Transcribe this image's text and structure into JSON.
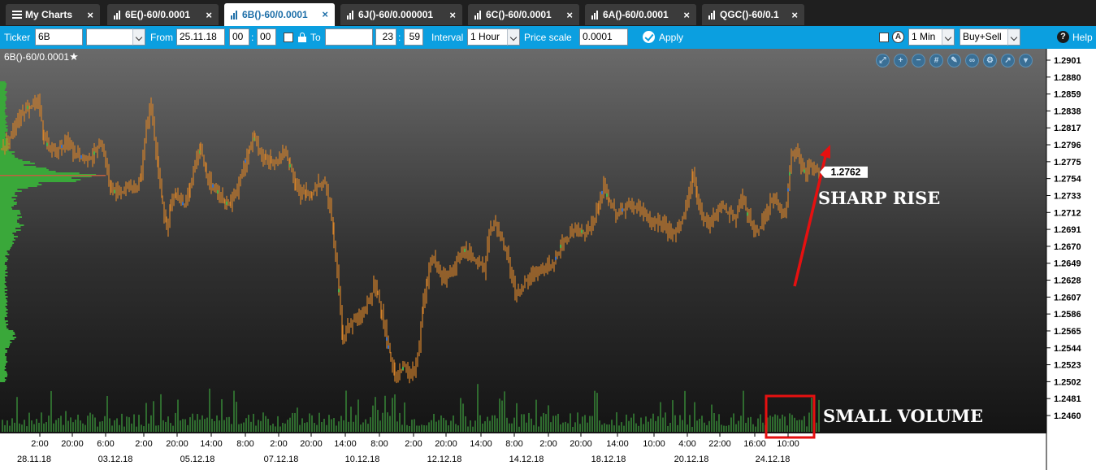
{
  "tabs": [
    {
      "label": "My Charts",
      "icon": "menu-icon",
      "active": false
    },
    {
      "label": "6E()-60/0.0001",
      "icon": "bar-chart-icon",
      "active": false
    },
    {
      "label": "6B()-60/0.0001",
      "icon": "bar-chart-icon",
      "active": true
    },
    {
      "label": "6J()-60/0.000001",
      "icon": "bar-chart-icon",
      "active": false
    },
    {
      "label": "6C()-60/0.0001",
      "icon": "bar-chart-icon",
      "active": false
    },
    {
      "label": "6A()-60/0.0001",
      "icon": "bar-chart-icon",
      "active": false
    },
    {
      "label": "QGC()-60/0.1",
      "icon": "bar-chart-icon",
      "active": false
    }
  ],
  "tab_close_glyph": "×",
  "toolbar": {
    "ticker_label": "Ticker",
    "ticker_value": "6B",
    "ticker_dropdown_value": "",
    "from_label": "From",
    "from_date": "25.11.18",
    "from_hour": "00",
    "from_minute": "00",
    "to_label": "To",
    "to_date": "",
    "to_hour": "23",
    "to_minute": "59",
    "time_separator": ":",
    "interval_label": "Interval",
    "interval_value": "1 Hour",
    "price_scale_label": "Price scale",
    "price_scale_value": "0.0001",
    "apply_label": "Apply",
    "circle_icon_glyph": "A",
    "timeframe_value": "1 Min",
    "side_value": "Buy+Sell",
    "help_label": "Help",
    "help_glyph": "?"
  },
  "chart": {
    "title": "6B()-60/0.0001",
    "star_glyph": "★",
    "tool_icons": [
      "zoom-fit-icon",
      "zoom-in-icon",
      "zoom-out-icon",
      "grid-icon",
      "draw-icon",
      "link-icon",
      "settings-icon",
      "expand-icon",
      "collapse-icon"
    ],
    "tool_glyphs": [
      "⤢",
      "+",
      "−",
      "#",
      "✎",
      "∞",
      "⚙",
      "↗",
      "▾"
    ],
    "annotations": {
      "sharp_rise": "SHARP RISE",
      "small_volume": "SMALL VOLUME"
    },
    "colors": {
      "candle": "#d4822a",
      "profile": "#3aa83a",
      "volume": "#2f6b2f",
      "accent": "#e61010",
      "poc_line": "#c06040"
    }
  },
  "chart_data": {
    "type": "ohlc",
    "ticker": "6B",
    "current_price": "1.2762",
    "y_ticks": [
      "1.2901",
      "1.2880",
      "1.2859",
      "1.2838",
      "1.2817",
      "1.2796",
      "1.2775",
      "1.2754",
      "1.2733",
      "1.2712",
      "1.2691",
      "1.2670",
      "1.2649",
      "1.2628",
      "1.2607",
      "1.2586",
      "1.2565",
      "1.2544",
      "1.2523",
      "1.2502",
      "1.2481",
      "1.2460"
    ],
    "x_time_ticks": [
      "2:00",
      "20:00",
      "6:00",
      "2:00",
      "20:00",
      "14:00",
      "8:00",
      "2:00",
      "20:00",
      "14:00",
      "8:00",
      "2:00",
      "20:00",
      "14:00",
      "8:00",
      "2:00",
      "20:00",
      "14:00",
      "10:00",
      "4:00",
      "22:00",
      "16:00",
      "10:00"
    ],
    "x_date_ticks": [
      "28.11.18",
      "03.12.18",
      "05.12.18",
      "07.12.18",
      "10.12.18",
      "12.12.18",
      "14.12.18",
      "18.12.18",
      "20.12.18",
      "24.12.18"
    ],
    "price_path": [
      [
        0,
        1.279
      ],
      [
        12,
        1.281
      ],
      [
        24,
        1.2835
      ],
      [
        35,
        1.2845
      ],
      [
        45,
        1.285
      ],
      [
        52,
        1.2808
      ],
      [
        60,
        1.2785
      ],
      [
        70,
        1.279
      ],
      [
        80,
        1.28
      ],
      [
        90,
        1.2785
      ],
      [
        100,
        1.278
      ],
      [
        112,
        1.2782
      ],
      [
        122,
        1.28
      ],
      [
        128,
        1.2775
      ],
      [
        135,
        1.274
      ],
      [
        145,
        1.2735
      ],
      [
        155,
        1.2745
      ],
      [
        165,
        1.2738
      ],
      [
        172,
        1.276
      ],
      [
        178,
        1.282
      ],
      [
        184,
        1.2845
      ],
      [
        188,
        1.2805
      ],
      [
        193,
        1.2765
      ],
      [
        198,
        1.2725
      ],
      [
        203,
        1.269
      ],
      [
        208,
        1.272
      ],
      [
        215,
        1.2735
      ],
      [
        225,
        1.272
      ],
      [
        232,
        1.2745
      ],
      [
        238,
        1.277
      ],
      [
        245,
        1.279
      ],
      [
        252,
        1.276
      ],
      [
        260,
        1.2745
      ],
      [
        268,
        1.2735
      ],
      [
        275,
        1.2725
      ],
      [
        282,
        1.272
      ],
      [
        290,
        1.274
      ],
      [
        298,
        1.277
      ],
      [
        305,
        1.279
      ],
      [
        312,
        1.2805
      ],
      [
        318,
        1.2785
      ],
      [
        325,
        1.278
      ],
      [
        332,
        1.2775
      ],
      [
        340,
        1.2778
      ],
      [
        348,
        1.2785
      ],
      [
        355,
        1.277
      ],
      [
        362,
        1.275
      ],
      [
        368,
        1.273
      ],
      [
        375,
        1.274
      ],
      [
        382,
        1.2735
      ],
      [
        390,
        1.275
      ],
      [
        398,
        1.2745
      ],
      [
        404,
        1.272
      ],
      [
        409,
        1.268
      ],
      [
        413,
        1.264
      ],
      [
        417,
        1.259
      ],
      [
        420,
        1.255
      ],
      [
        424,
        1.257
      ],
      [
        430,
        1.2575
      ],
      [
        438,
        1.258
      ],
      [
        446,
        1.259
      ],
      [
        452,
        1.26
      ],
      [
        458,
        1.262
      ],
      [
        463,
        1.261
      ],
      [
        468,
        1.259
      ],
      [
        474,
        1.2555
      ],
      [
        479,
        1.253
      ],
      [
        484,
        1.251
      ],
      [
        490,
        1.2515
      ],
      [
        496,
        1.252
      ],
      [
        502,
        1.2512
      ],
      [
        508,
        1.252
      ],
      [
        514,
        1.255
      ],
      [
        519,
        1.26
      ],
      [
        524,
        1.263
      ],
      [
        530,
        1.266
      ],
      [
        538,
        1.264
      ],
      [
        546,
        1.263
      ],
      [
        554,
        1.264
      ],
      [
        562,
        1.2655
      ],
      [
        570,
        1.2665
      ],
      [
        578,
        1.266
      ],
      [
        586,
        1.265
      ],
      [
        594,
        1.264
      ],
      [
        600,
        1.269
      ],
      [
        608,
        1.2695
      ],
      [
        616,
        1.268
      ],
      [
        624,
        1.265
      ],
      [
        632,
        1.261
      ],
      [
        640,
        1.262
      ],
      [
        648,
        1.263
      ],
      [
        656,
        1.2635
      ],
      [
        664,
        1.264
      ],
      [
        672,
        1.2645
      ],
      [
        680,
        1.265
      ],
      [
        688,
        1.267
      ],
      [
        696,
        1.268
      ],
      [
        704,
        1.269
      ],
      [
        712,
        1.2688
      ],
      [
        720,
        1.269
      ],
      [
        728,
        1.27
      ],
      [
        735,
        1.272
      ],
      [
        741,
        1.2745
      ],
      [
        748,
        1.2725
      ],
      [
        756,
        1.271
      ],
      [
        764,
        1.2715
      ],
      [
        772,
        1.272
      ],
      [
        780,
        1.272
      ],
      [
        790,
        1.271
      ],
      [
        800,
        1.27
      ],
      [
        808,
        1.27
      ],
      [
        816,
        1.2695
      ],
      [
        824,
        1.2685
      ],
      [
        832,
        1.269
      ],
      [
        840,
        1.271
      ],
      [
        846,
        1.2735
      ],
      [
        851,
        1.276
      ],
      [
        856,
        1.273
      ],
      [
        862,
        1.271
      ],
      [
        870,
        1.27
      ],
      [
        878,
        1.271
      ],
      [
        886,
        1.272
      ],
      [
        894,
        1.2712
      ],
      [
        902,
        1.2705
      ],
      [
        910,
        1.273
      ],
      [
        918,
        1.271
      ],
      [
        926,
        1.269
      ],
      [
        934,
        1.2695
      ],
      [
        942,
        1.2715
      ],
      [
        950,
        1.273
      ],
      [
        958,
        1.272
      ],
      [
        964,
        1.271
      ],
      [
        968,
        1.274
      ],
      [
        972,
        1.278
      ],
      [
        978,
        1.279
      ],
      [
        984,
        1.277
      ],
      [
        990,
        1.276
      ],
      [
        996,
        1.277
      ],
      [
        1002,
        1.2765
      ],
      [
        1008,
        1.2762
      ]
    ]
  }
}
